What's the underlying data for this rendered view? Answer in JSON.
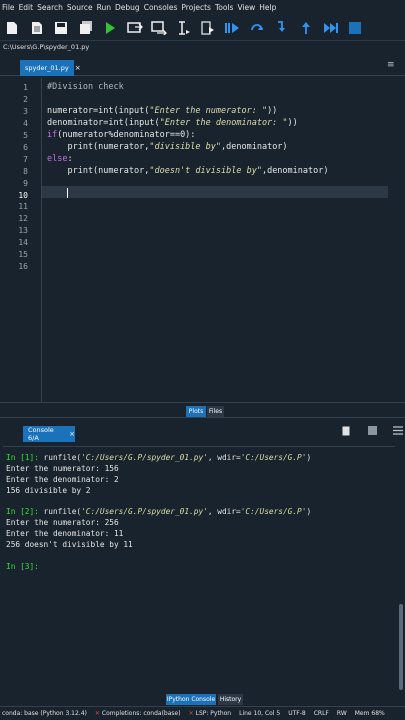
{
  "menu": [
    "File",
    "Edit",
    "Search",
    "Source",
    "Run",
    "Debug",
    "Consoles",
    "Projects",
    "Tools",
    "View",
    "Help"
  ],
  "toolbar": {
    "icons": [
      "new-file-icon",
      "open-file-icon",
      "save-file-icon",
      "save-all-icon",
      "run-icon",
      "run-cell-icon",
      "run-cell-advance-icon",
      "run-selection-icon",
      "debug-icon",
      "step-icon",
      "step-into-icon",
      "continue-icon",
      "stop-icon"
    ],
    "colors": {
      "run": "#31c631",
      "blue": "#3294ef",
      "stop": "#1a72bb"
    }
  },
  "path": "C:\\Users\\G.P\\spyder_01.py",
  "editor": {
    "tab_label": "spyder_01.py",
    "tab_close": "×",
    "pane_menu": "≡",
    "line_numbers": [
      "1",
      "2",
      "3",
      "4",
      "5",
      "6",
      "7",
      "8",
      "9",
      "10",
      "11",
      "12",
      "13",
      "14",
      "15",
      "16"
    ],
    "code": {
      "l1": "#Division check",
      "l3_a": "numerator=int(input(",
      "l3_s": "\"Enter the numerator: \"",
      "l3_b": "))",
      "l4_a": "denominator=int(input(",
      "l4_s": "\"Enter the denominator: \"",
      "l4_b": "))",
      "l5_kw": "if",
      "l5_b": "(numerator%denominator==0):",
      "l6_a": "    print(numerator,",
      "l6_s": "\"divisible by\"",
      "l6_b": ",denominator)",
      "l7_kw": "else",
      "l7_b": ":",
      "l8_a": "    print(numerator,",
      "l8_s": "\"doesn't divisible by\"",
      "l8_b": ",denominator)"
    }
  },
  "middle_tabs": {
    "plots": "Plots",
    "files": "Files"
  },
  "console": {
    "tab_label": "Console 6/A",
    "tab_close": "×",
    "icons": [
      "copy-icon",
      "stop-icon",
      "menu-icon"
    ],
    "lines": {
      "p1": "In [1]:",
      "r1_a": " runfile(",
      "r1_s1": "'C:/Users/G.P/spyder_01.py'",
      "r1_b": ", wdir=",
      "r1_s2": "'C:/Users/G.P'",
      "r1_c": ")",
      "o1": "Enter the numerator: 156",
      "o2": "Enter the denominator: 2",
      "o3": "156 divisible by 2",
      "p2": "In [2]:",
      "r2_a": " runfile(",
      "r2_s1": "'C:/Users/G.P/spyder_01.py'",
      "r2_b": ", wdir=",
      "r2_s2": "'C:/Users/G.P'",
      "r2_c": ")",
      "o4": "Enter the numerator: 256",
      "o5": "Enter the denominator: 11",
      "o6": "256 doesn't divisible by 11",
      "p3": "In [3]:"
    }
  },
  "bottom_tabs": {
    "ipython": "IPython Console",
    "history": "History"
  },
  "status": {
    "conda": "conda: base (Python 3.12.4)",
    "completions": "Completions: conda(base)",
    "lsp": "LSP: Python",
    "position": "Line 10, Col 5",
    "encoding": "UTF-8",
    "eol": "CRLF",
    "mode": "RW",
    "mem": "Mem 68%"
  }
}
